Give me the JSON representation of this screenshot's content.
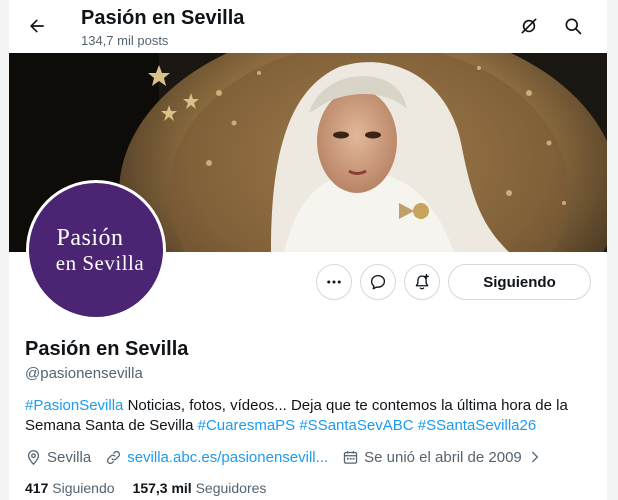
{
  "header": {
    "title": "Pasión en Sevilla",
    "posts_count": "134,7 mil posts"
  },
  "avatar": {
    "line1": "Pasión",
    "line2": "en Sevilla",
    "bg_color": "#4b2473"
  },
  "actions": {
    "follow_label": "Siguiendo",
    "icons": [
      "more-icon",
      "message-icon",
      "notify-icon"
    ]
  },
  "profile": {
    "name": "Pasión en Sevilla",
    "handle": "@pasionensevilla",
    "bio": {
      "tag1": "#PasionSevilla",
      "text1": " Noticias, fotos, vídeos... Deja que te contemos la última hora de la Semana Santa de Sevilla ",
      "tag2": "#CuaresmaPS",
      "tag3": "#SSantaSevABC",
      "tag4": "#SSantaSevilla26"
    },
    "location": "Sevilla",
    "website": "sevilla.abc.es/pasionensevill...",
    "joined": "Se unió el abril de 2009"
  },
  "stats": {
    "following_count": "417",
    "following_label": "Siguiendo",
    "followers_count": "157,3 mil",
    "followers_label": "Seguidores"
  },
  "colors": {
    "accent": "#1d9bf0",
    "text": "#0f1419",
    "muted": "#536471"
  }
}
